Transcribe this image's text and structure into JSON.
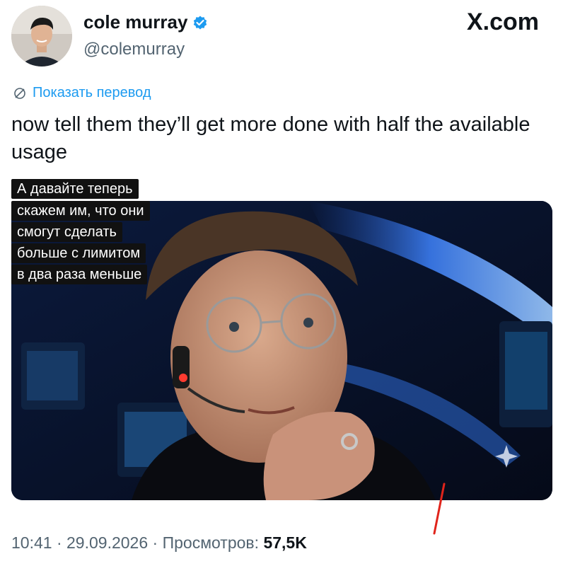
{
  "author": {
    "name": "cole murray",
    "handle": "@colemurray"
  },
  "brand": "X.com",
  "translate_label": "Показать перевод",
  "tweet_text": "now tell them they’ll get more done with half the available usage",
  "media": {
    "caption_lines": [
      "А давайте теперь",
      "скажем им, что они",
      "смогут сделать",
      "больше с лимитом",
      "в два раза меньше"
    ]
  },
  "meta": {
    "time": "10:41",
    "date": "29.09.2026",
    "views_label": "Просмотров:",
    "views_count": "57,5K"
  },
  "colors": {
    "accent": "#1d9bf0",
    "verified": "#1d9bf0",
    "text": "#0f1419",
    "muted": "#536471",
    "annotation": "#e0241b"
  },
  "icons": [
    "verified-badge-icon",
    "translate-icon",
    "sparkle-icon"
  ]
}
